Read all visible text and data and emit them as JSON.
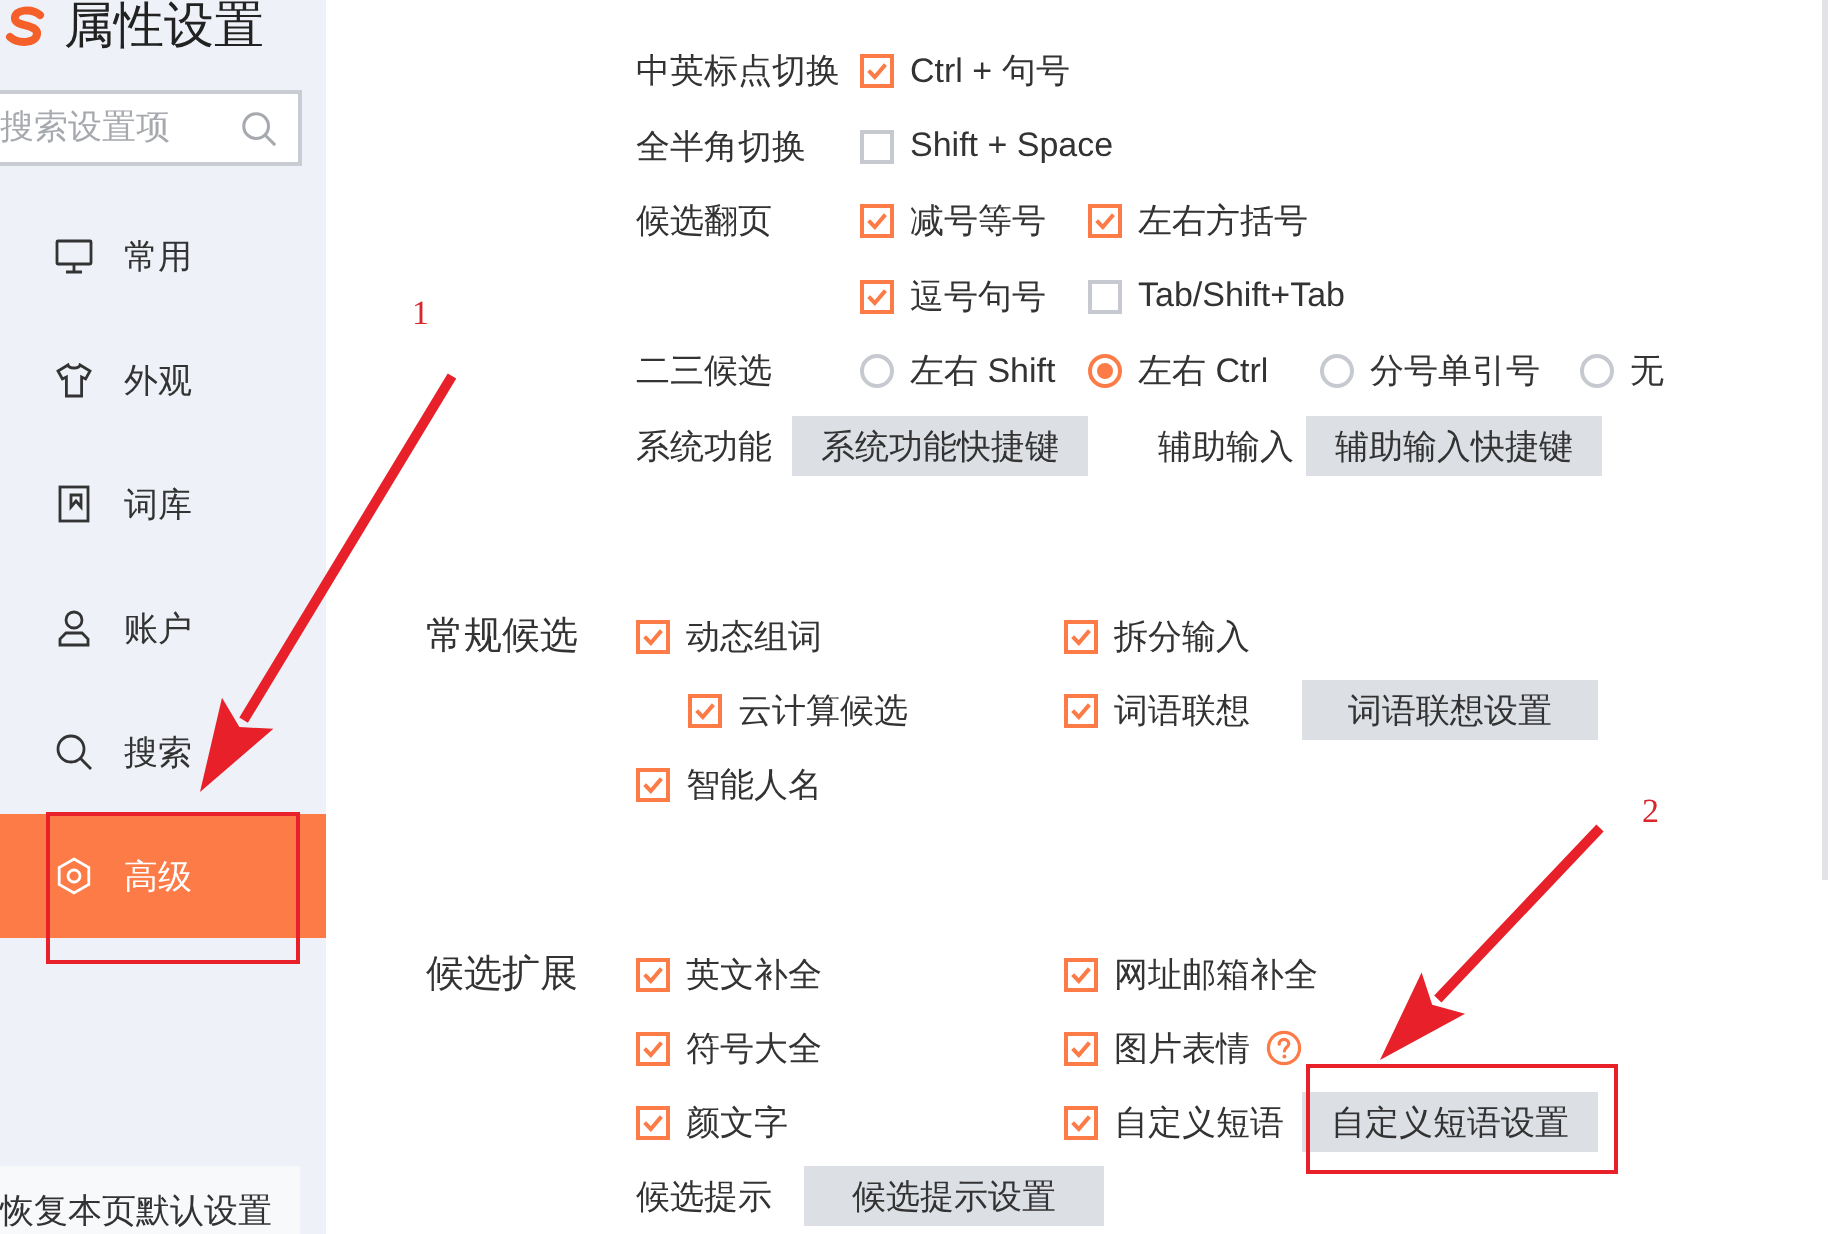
{
  "sidebar": {
    "title": "属性设置",
    "search": {
      "placeholder": "搜索设置项"
    },
    "items": [
      {
        "label": "常用",
        "selected": false
      },
      {
        "label": "外观",
        "selected": false
      },
      {
        "label": "词库",
        "selected": false
      },
      {
        "label": "账户",
        "selected": false
      },
      {
        "label": "搜索",
        "selected": false
      },
      {
        "label": "高级",
        "selected": true
      }
    ],
    "restore_button": "恢复本页默认设置"
  },
  "shortcuts": {
    "rows": [
      {
        "kind": "options",
        "label": "中英标点切换",
        "options": [
          {
            "kind": "checkbox",
            "label": "Ctrl + 句号",
            "checked": true
          }
        ]
      },
      {
        "kind": "options",
        "label": "全半角切换",
        "options": [
          {
            "kind": "checkbox",
            "label": "Shift + Space",
            "checked": false
          }
        ]
      },
      {
        "kind": "options",
        "label": "候选翻页",
        "options": [
          {
            "kind": "checkbox",
            "label": "减号等号",
            "checked": true
          },
          {
            "kind": "checkbox",
            "label": "左右方括号",
            "checked": true
          }
        ]
      },
      {
        "kind": "options",
        "options": [
          {
            "kind": "checkbox",
            "label": "逗号句号",
            "checked": true
          },
          {
            "kind": "checkbox",
            "label": "Tab/Shift+Tab",
            "checked": false
          }
        ]
      },
      {
        "kind": "options",
        "label": "二三候选",
        "options": [
          {
            "kind": "radio",
            "label": "左右 Shift",
            "selected": false
          },
          {
            "kind": "radio",
            "label": "左右 Ctrl",
            "selected": true
          },
          {
            "kind": "radio",
            "label": "分号单引号",
            "selected": false
          },
          {
            "kind": "radio",
            "label": "无",
            "selected": false
          }
        ]
      },
      {
        "kind": "buttons",
        "groups": [
          {
            "label": "系统功能",
            "button": "系统功能快捷键"
          },
          {
            "label": "辅助输入",
            "button": "辅助输入快捷键"
          }
        ]
      }
    ]
  },
  "sections": [
    {
      "title": "常规候选",
      "columns": [
        [
          {
            "label": "动态组词",
            "checked": true,
            "children": [
              {
                "label": "云计算候选",
                "checked": true
              }
            ]
          },
          {
            "label": "智能人名",
            "checked": true
          }
        ],
        [
          {
            "label": "拆分输入",
            "checked": true
          },
          {
            "label": "词语联想",
            "checked": true,
            "button": "词语联想设置"
          }
        ]
      ]
    },
    {
      "title": "候选扩展",
      "columns": [
        [
          {
            "label": "英文补全",
            "checked": true
          },
          {
            "label": "符号大全",
            "checked": true
          },
          {
            "label": "颜文字",
            "checked": true
          }
        ],
        [
          {
            "label": "网址邮箱补全",
            "checked": true
          },
          {
            "label": "图片表情",
            "checked": true,
            "help": true
          },
          {
            "label": "自定义短语",
            "checked": true,
            "button": "自定义短语设置"
          }
        ]
      ],
      "footer": {
        "label": "候选提示",
        "button": "候选提示设置"
      }
    }
  ],
  "annotations": [
    {
      "number": "1"
    },
    {
      "number": "2"
    }
  ]
}
